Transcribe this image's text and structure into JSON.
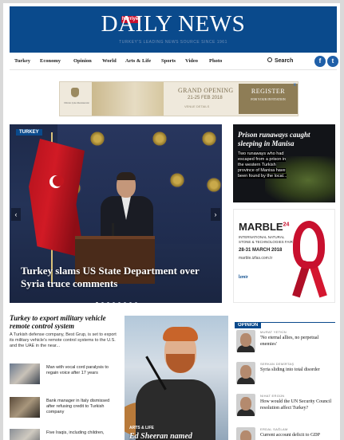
{
  "masthead": {
    "title": "DAILY NEWS",
    "badge": "hürriyet",
    "tagline": "TURKEY'S LEADING NEWS SOURCE SINCE 1961"
  },
  "nav": {
    "items": [
      "Turkey",
      "Economy",
      "Opinion",
      "World",
      "Arts & Life",
      "Sports",
      "Video",
      "Photo"
    ],
    "search_label": "Search",
    "social": [
      "f",
      "t"
    ]
  },
  "ad": {
    "brand": "Divan Çıkı Restaurant",
    "title": "GRAND OPENING",
    "dates": "21-25 FEB 2018",
    "small": "VENUE DETAILS",
    "register": "REGISTER",
    "register_sub": "FOR YOUR INVITATION",
    "close": "X"
  },
  "hero": {
    "tag": "TURKEY",
    "title": "Turkey slams US State Department over Syria truce comments",
    "slides": 8,
    "active_slide": 0
  },
  "side_story": {
    "title": "Prison runaways caught sleeping in Manisa",
    "text": "Two runaways who had escaped from a prison in the western Turkish province of Manisa have been found by the local..."
  },
  "side_ad": {
    "brand": "MARBLE",
    "edition": "24",
    "subtitle": "INTERNATIONAL NATURAL STONE & TECHNOLOGIES FAIR",
    "dates": "28-31 MARCH 2018",
    "url": "marble.izfas.com.tr",
    "organizer": "İzmir"
  },
  "left_story": {
    "title": "Turkey to export military vehicle remote control system",
    "text": "A Turkish defense company, Best Grup, is set to export its military vehicle's remote control systems to the U.S. and the UAE in the near..."
  },
  "list": [
    {
      "text": "Man with vocal cord paralysis to regain voice after 17 years"
    },
    {
      "text": "Bank manager in Italy dismissed after refusing credit to Turkish company"
    },
    {
      "text": "Five Iraqis, including children,"
    }
  ],
  "center_story": {
    "tag": "ARTS & LIFE",
    "title": "Ed Sheeran named"
  },
  "opinion": {
    "heading": "OPINION",
    "items": [
      {
        "author": "MURAT YETKİN",
        "title": "'No eternal allies, no perpetual enemies'"
      },
      {
        "author": "SERKAN DEMİRTAŞ",
        "title": "Syria sliding into total disorder"
      },
      {
        "author": "NIHAT ERGÜN",
        "title": "How would the UN Security Council resolution affect Turkey?"
      },
      {
        "author": "ERDAL SAĞLAM",
        "title": "Current account deficit to GDP"
      }
    ]
  }
}
